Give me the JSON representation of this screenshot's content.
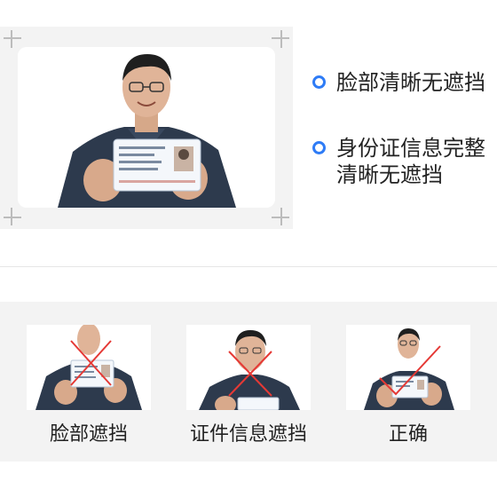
{
  "tips": [
    {
      "text": "脸部清晰无遮挡"
    },
    {
      "text": "身份证信息完整清晰无遮挡"
    }
  ],
  "examples": [
    {
      "label": "脸部遮挡",
      "mark": "cross-mark-icon"
    },
    {
      "label": "证件信息遮挡",
      "mark": "cross-mark-icon"
    },
    {
      "label": "正确",
      "mark": "check-mark-icon"
    }
  ],
  "colors": {
    "accent": "#2f7cf6",
    "error_mark": "#e53935",
    "section_bg": "#f3f3f3"
  }
}
